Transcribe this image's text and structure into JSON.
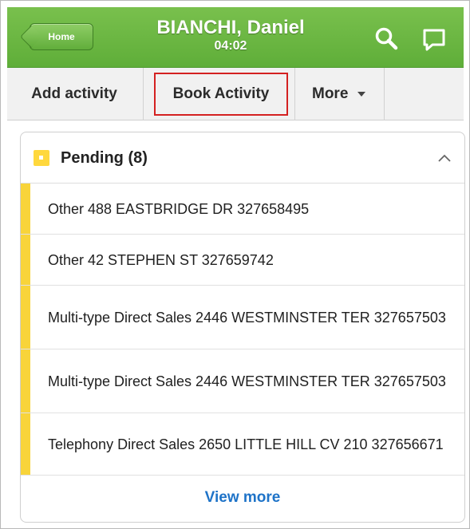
{
  "header": {
    "home_label": "Home",
    "title": "BIANCHI, Daniel",
    "subtitle": "04:02",
    "search_icon": "search-icon",
    "chat_icon": "chat-bubble-icon",
    "color": "#6ab743"
  },
  "tabs": {
    "add_activity": "Add activity",
    "book_activity": "Book Activity",
    "more": "More",
    "highlight_color": "#d42121"
  },
  "panel": {
    "title": "Pending (8)",
    "badge_color": "#ffd83d",
    "items": [
      {
        "label": "Other 488 EASTBRIDGE DR 327658495"
      },
      {
        "label": "Other 42 STEPHEN ST 327659742"
      },
      {
        "label": "Multi-type Direct Sales 2446 WESTMINSTER TER 327657503"
      },
      {
        "label": "Multi-type Direct Sales 2446 WESTMINSTER TER 327657503"
      },
      {
        "label": "Telephony Direct Sales 2650 LITTLE HILL CV 210 327656671"
      }
    ],
    "view_more": "View more",
    "link_color": "#1e73c8"
  }
}
